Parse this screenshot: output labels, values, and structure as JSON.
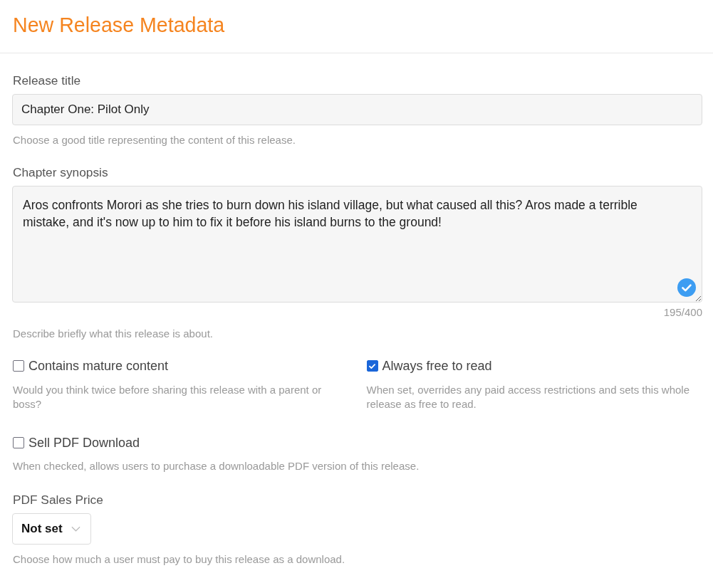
{
  "header": {
    "title": "New Release Metadata"
  },
  "form": [
    {
      "kind": "text",
      "label": "Release title",
      "value": "Chapter One: Pilot Only",
      "hint": "Choose a good title representing the content of this release."
    },
    {
      "kind": "textarea",
      "label": "Chapter synopsis",
      "value": "Aros confronts Morori as she tries to burn down his island village, but what caused all this? Aros made a terrible mistake, and it's now up to him to fix it before his island burns to the ground!",
      "valid": true,
      "counter": "195/400",
      "hint": "Describe briefly what this release is about."
    },
    {
      "kind": "checks",
      "options": [
        {
          "label": "Contains mature content",
          "checked": false,
          "hint": "Would you think twice before sharing this release with a parent or boss?"
        },
        {
          "label": "Always free to read",
          "checked": true,
          "hint": "When set, overrides any paid access restrictions and sets this whole release as free to read."
        }
      ]
    },
    {
      "kind": "checks",
      "options": [
        {
          "label": "Sell PDF Download",
          "checked": false,
          "hint": "When checked, allows users to purchase a downloadable PDF version of this release."
        }
      ]
    },
    {
      "kind": "select",
      "label": "PDF Sales Price",
      "value": "Not set",
      "hint": "Choose how much a user must pay to buy this release as a download."
    }
  ]
}
